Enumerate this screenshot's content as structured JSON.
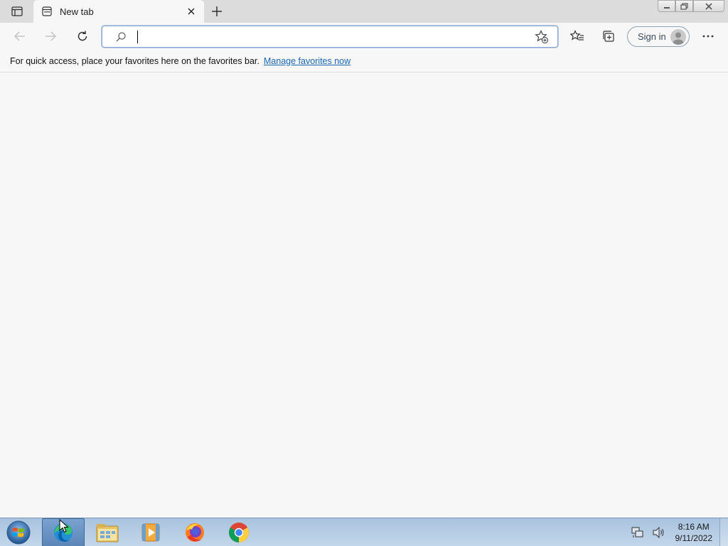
{
  "browser": {
    "tab": {
      "title": "New tab"
    },
    "address_bar": {
      "value": "",
      "placeholder": ""
    },
    "signin_label": "Sign in",
    "favorites_bar": {
      "message": "For quick access, place your favorites here on the favorites bar.",
      "link": "Manage favorites now"
    }
  },
  "taskbar": {
    "apps": [
      {
        "name": "Microsoft Edge",
        "icon": "edge-icon",
        "active": true
      },
      {
        "name": "File Explorer",
        "icon": "file-explorer-icon",
        "active": false
      },
      {
        "name": "Windows Media Player",
        "icon": "media-player-icon",
        "active": false
      },
      {
        "name": "Firefox",
        "icon": "firefox-icon",
        "active": false
      },
      {
        "name": "Google Chrome",
        "icon": "chrome-icon",
        "active": false
      }
    ],
    "clock": {
      "time": "8:16 AM",
      "date": "9/11/2022"
    }
  },
  "colors": {
    "link": "#1a66b2",
    "taskbar": "#b3cbe3",
    "tabstrip": "#dcdcdc",
    "page_bg": "#f7f7f7"
  }
}
